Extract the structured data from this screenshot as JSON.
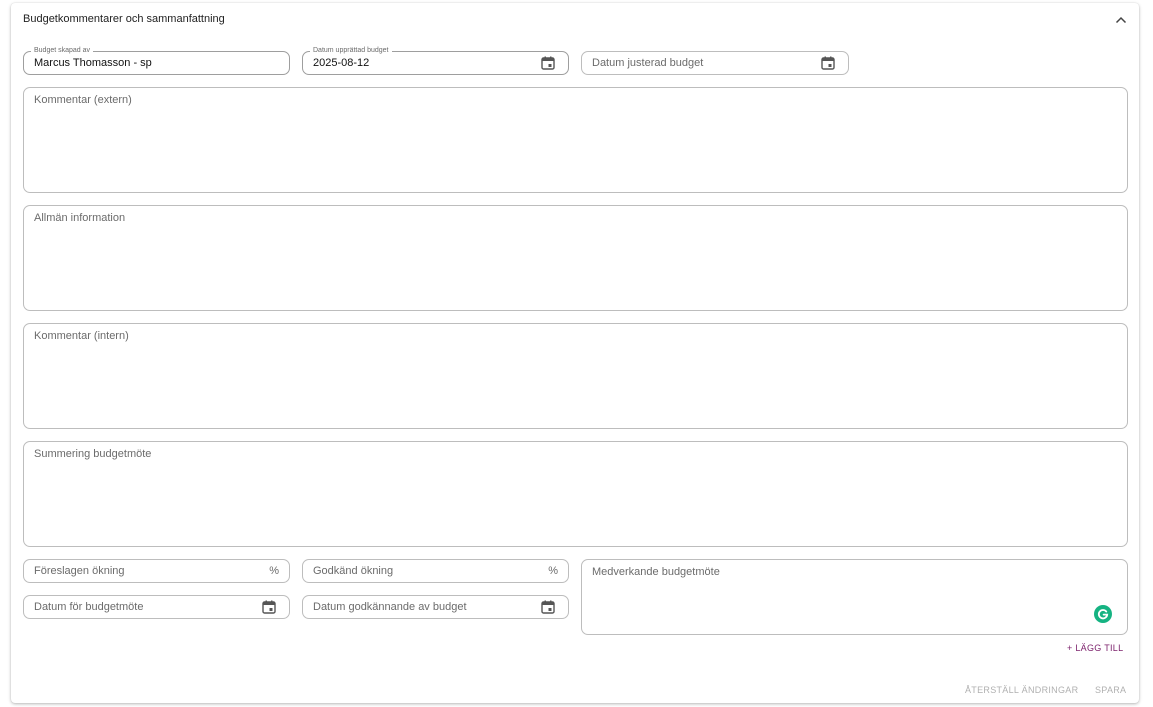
{
  "section": {
    "title": "Budgetkommentarer och sammanfattning"
  },
  "fields": {
    "created_by": {
      "label": "Budget skapad av",
      "value": "Marcus Thomasson - sp"
    },
    "date_prepared": {
      "label": "Datum upprättad budget",
      "value": "2025-08-12"
    },
    "date_adjusted": {
      "placeholder": "Datum justerad budget"
    },
    "comment_external": {
      "placeholder": "Kommentar (extern)"
    },
    "general_info": {
      "placeholder": "Allmän information"
    },
    "comment_internal": {
      "placeholder": "Kommentar (intern)"
    },
    "meeting_summary": {
      "placeholder": "Summering budgetmöte"
    },
    "proposed_increase": {
      "placeholder": "Föreslagen ökning",
      "suffix": "%"
    },
    "approved_increase": {
      "placeholder": "Godkänd ökning",
      "suffix": "%"
    },
    "meeting_participants": {
      "placeholder": "Medverkande budgetmöte"
    },
    "meeting_date": {
      "placeholder": "Datum för budgetmöte"
    },
    "approval_date": {
      "placeholder": "Datum godkännande av budget"
    }
  },
  "actions": {
    "add_label": "+ LÄGG TILL",
    "reset_label": "ÅTERSTÄLL ÄNDRINGAR",
    "save_label": "SPARA"
  },
  "icons": {
    "collapse": "chevron-up-icon",
    "calendar": "calendar-icon",
    "grammarly": "grammarly-icon"
  },
  "colors": {
    "accent": "#7b1f6a",
    "grammarly": "#15b382",
    "disabled_text": "#b0b0b0",
    "border": "#bdbdbd"
  }
}
